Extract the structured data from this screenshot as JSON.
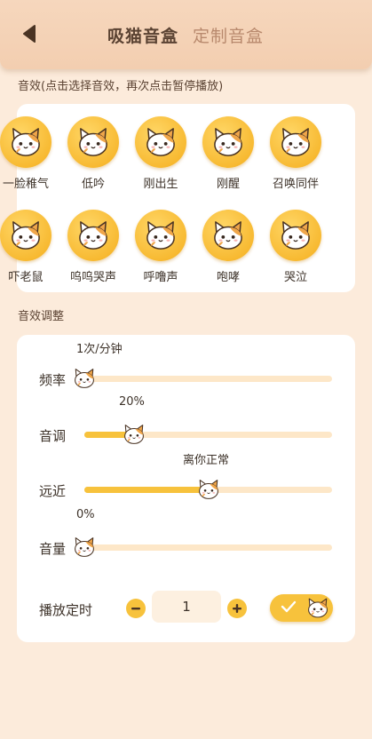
{
  "header": {
    "active_tab": "吸猫音盒",
    "inactive_tab": "定制音盒"
  },
  "sound_effects": {
    "section_title": "音效(点击选择音效，再次点击暂停播放)",
    "items": [
      {
        "label": "一脸稚气"
      },
      {
        "label": "低吟"
      },
      {
        "label": "刚出生"
      },
      {
        "label": "刚醒"
      },
      {
        "label": "召唤同伴"
      },
      {
        "label": "吓老鼠"
      },
      {
        "label": "呜呜哭声"
      },
      {
        "label": "呼噜声"
      },
      {
        "label": "咆哮"
      },
      {
        "label": "哭泣"
      }
    ]
  },
  "adjustments": {
    "section_title": "音效调整",
    "frequency": {
      "label": "频率",
      "value_text": "1次/分钟",
      "level_percent": 0
    },
    "pitch": {
      "label": "音调",
      "value_text": "20%",
      "level_percent": 20
    },
    "distance": {
      "label": "远近",
      "value_text": "离你正常",
      "level_percent": 50
    },
    "volume": {
      "label": "音量",
      "value_text": "0%",
      "level_percent": 0
    }
  },
  "timer": {
    "label": "播放定时",
    "value": "1",
    "enabled": true
  },
  "colors": {
    "accent": "#f7c23c",
    "background": "#fcebdb",
    "track": "#fde7c8"
  },
  "icons": {
    "back": "triangle-left-icon",
    "cat": "cat-face-icon",
    "minus": "minus-icon",
    "plus": "plus-icon",
    "check": "check-icon"
  }
}
